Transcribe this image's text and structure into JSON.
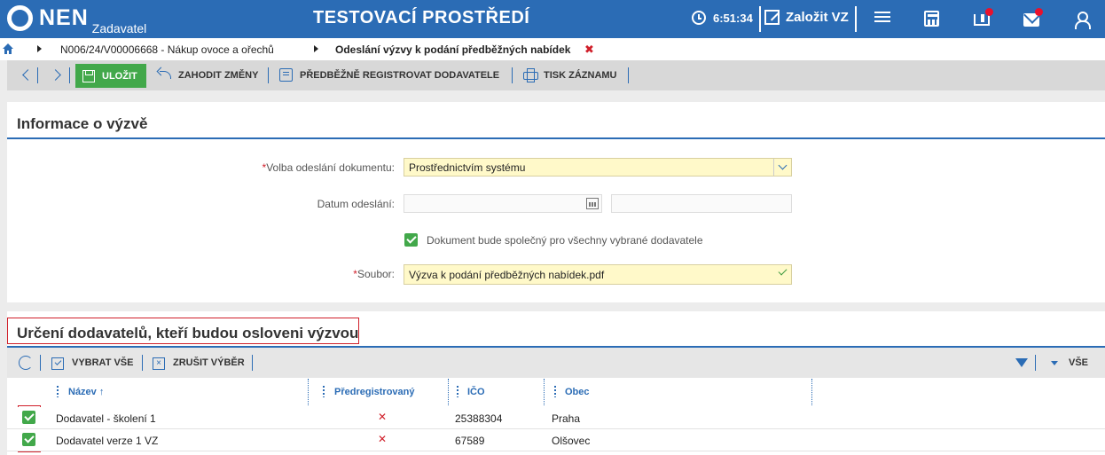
{
  "header": {
    "logo_text": "NEN",
    "logo_sub": "Zadavatel",
    "env_title": "TESTOVACÍ PROSTŘEDÍ",
    "time": "6:51:34",
    "new_vz": "Založit VZ"
  },
  "breadcrumb": {
    "items": [
      "N006/24/V00006668 - Nákup ovoce a ořechů",
      "Odeslání výzvy k podání předběžných nabídek"
    ],
    "close_symbol": "✖"
  },
  "toolbar": {
    "save": "ULOŽIT",
    "discard": "ZAHODIT ZMĚNY",
    "preregister": "PŘEDBĚŽNĚ REGISTROVAT DODAVATELE",
    "print": "TISK ZÁZNAMU"
  },
  "info": {
    "title": "Informace o výzvě",
    "send_choice_label": "Volba odeslání dokumentu:",
    "send_choice_value": "Prostřednictvím systému",
    "date_label": "Datum odeslání:",
    "shared_checkbox_label": "Dokument bude společný pro všechny vybrané dodavatele",
    "file_label": "Soubor:",
    "file_value": "Výzva k podání předběžných nabídek.pdf",
    "required_mark": "*"
  },
  "suppliers": {
    "title": "Určení dodavatelů, kteří budou osloveni výzvou",
    "select_all": "VYBRAT VŠE",
    "deselect": "ZRUŠIT VÝBĚR",
    "all_label": "VŠE",
    "columns": [
      "Název ↑",
      "Předregistrovaný",
      "IČO",
      "Obec"
    ],
    "rows": [
      {
        "name": "Dodavatel - školení 1",
        "prereg": "✕",
        "ico": "25388304",
        "obec": "Praha"
      },
      {
        "name": "Dodavatel verze 1 VZ",
        "prereg": "✕",
        "ico": "67589",
        "obec": "Olšovec"
      }
    ]
  },
  "colors": {
    "brand_blue": "#2b6cb5",
    "save_green": "#42a84a",
    "field_yellow": "#fff9c9",
    "alert_red": "#d01f2a"
  }
}
